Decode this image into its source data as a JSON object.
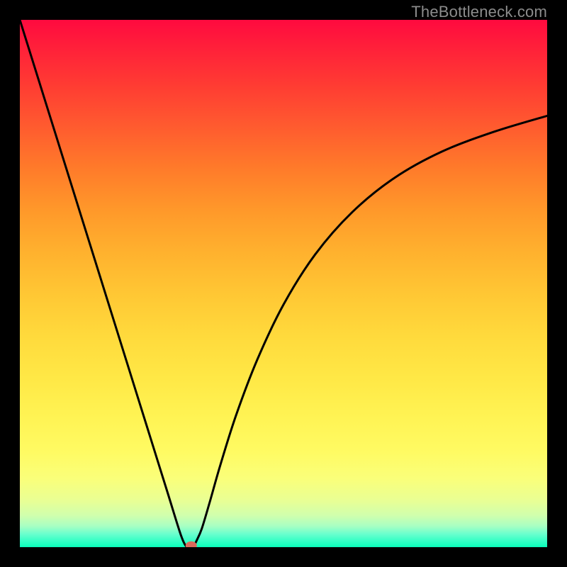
{
  "watermark": "TheBottleneck.com",
  "chart_data": {
    "type": "line",
    "title": "",
    "xlabel": "",
    "ylabel": "",
    "xlim": [
      0,
      100
    ],
    "ylim": [
      0,
      100
    ],
    "series": [
      {
        "name": "bottleneck-curve",
        "x": [
          0,
          5,
          10,
          15,
          18,
          22,
          25,
          28,
          30.5,
          31.5,
          32.0,
          32.3,
          32.7,
          33.0,
          33.5,
          34.5,
          36,
          38,
          41,
          45,
          50,
          56,
          63,
          71,
          80,
          90,
          100
        ],
        "values": [
          100,
          84.0,
          68.0,
          52.0,
          42.4,
          29.6,
          20.0,
          10.4,
          2.4,
          0.2,
          0.0,
          0.0,
          0.0,
          0.2,
          1.2,
          3.5,
          8.5,
          15.5,
          25.0,
          35.5,
          46.0,
          55.5,
          63.5,
          70.0,
          75.0,
          78.8,
          81.8
        ]
      }
    ],
    "marker": {
      "x": 32.5,
      "y": 0.3,
      "color": "#d96a5c"
    }
  },
  "colors": {
    "background": "#000000",
    "curve": "#000000",
    "marker": "#d96a5c"
  }
}
